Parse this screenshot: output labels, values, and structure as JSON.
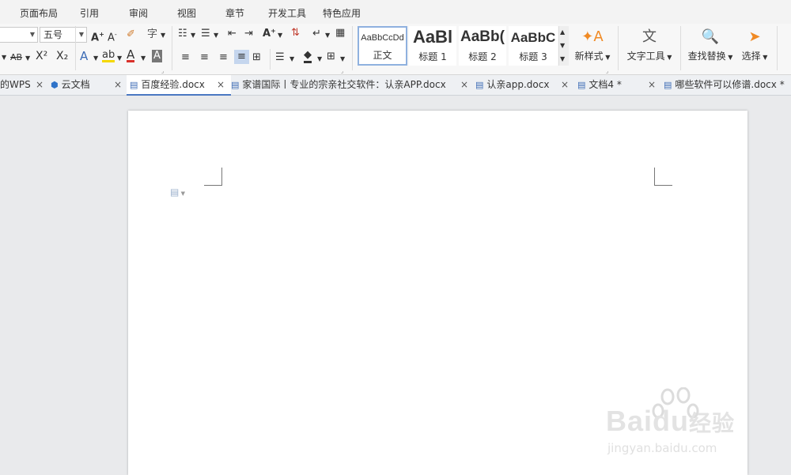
{
  "menu": [
    "页面布局",
    "引用",
    "审阅",
    "视图",
    "章节",
    "开发工具",
    "特色应用"
  ],
  "toolbar": {
    "font_size_value": "五号",
    "superscript_label": "X²",
    "subscript_label": "X₂",
    "styles": [
      {
        "sample": "AaBbCcDd",
        "label": "正文"
      },
      {
        "sample": "AaBl",
        "label": "标题 1"
      },
      {
        "sample": "AaBb(",
        "label": "标题 2"
      },
      {
        "sample": "AaBbC",
        "label": "标题 3"
      }
    ],
    "new_style_label": "新样式",
    "text_tools_label": "文字工具",
    "find_replace_label": "查找替换",
    "select_label": "选择"
  },
  "tabs": [
    {
      "title": "的WPS",
      "active": false
    },
    {
      "title": "云文档",
      "active": false
    },
    {
      "title": "百度经验.docx",
      "active": true
    },
    {
      "title": "家谱国际丨专业的宗亲社交软件：认亲APP.docx",
      "active": false
    },
    {
      "title": "认亲app.docx",
      "active": false
    },
    {
      "title": "文档4 *",
      "active": false
    },
    {
      "title": "哪些软件可以修谱.docx *",
      "active": false
    }
  ],
  "watermark": {
    "brand": "Baidu",
    "suffix": "经验",
    "url": "jingyan.baidu.com"
  },
  "colors": {
    "active_tab_underline": "#4a78c2",
    "highlight_yellow": "#f5d800",
    "font_red": "#d9312b",
    "accent_orange": "#f08a24"
  }
}
